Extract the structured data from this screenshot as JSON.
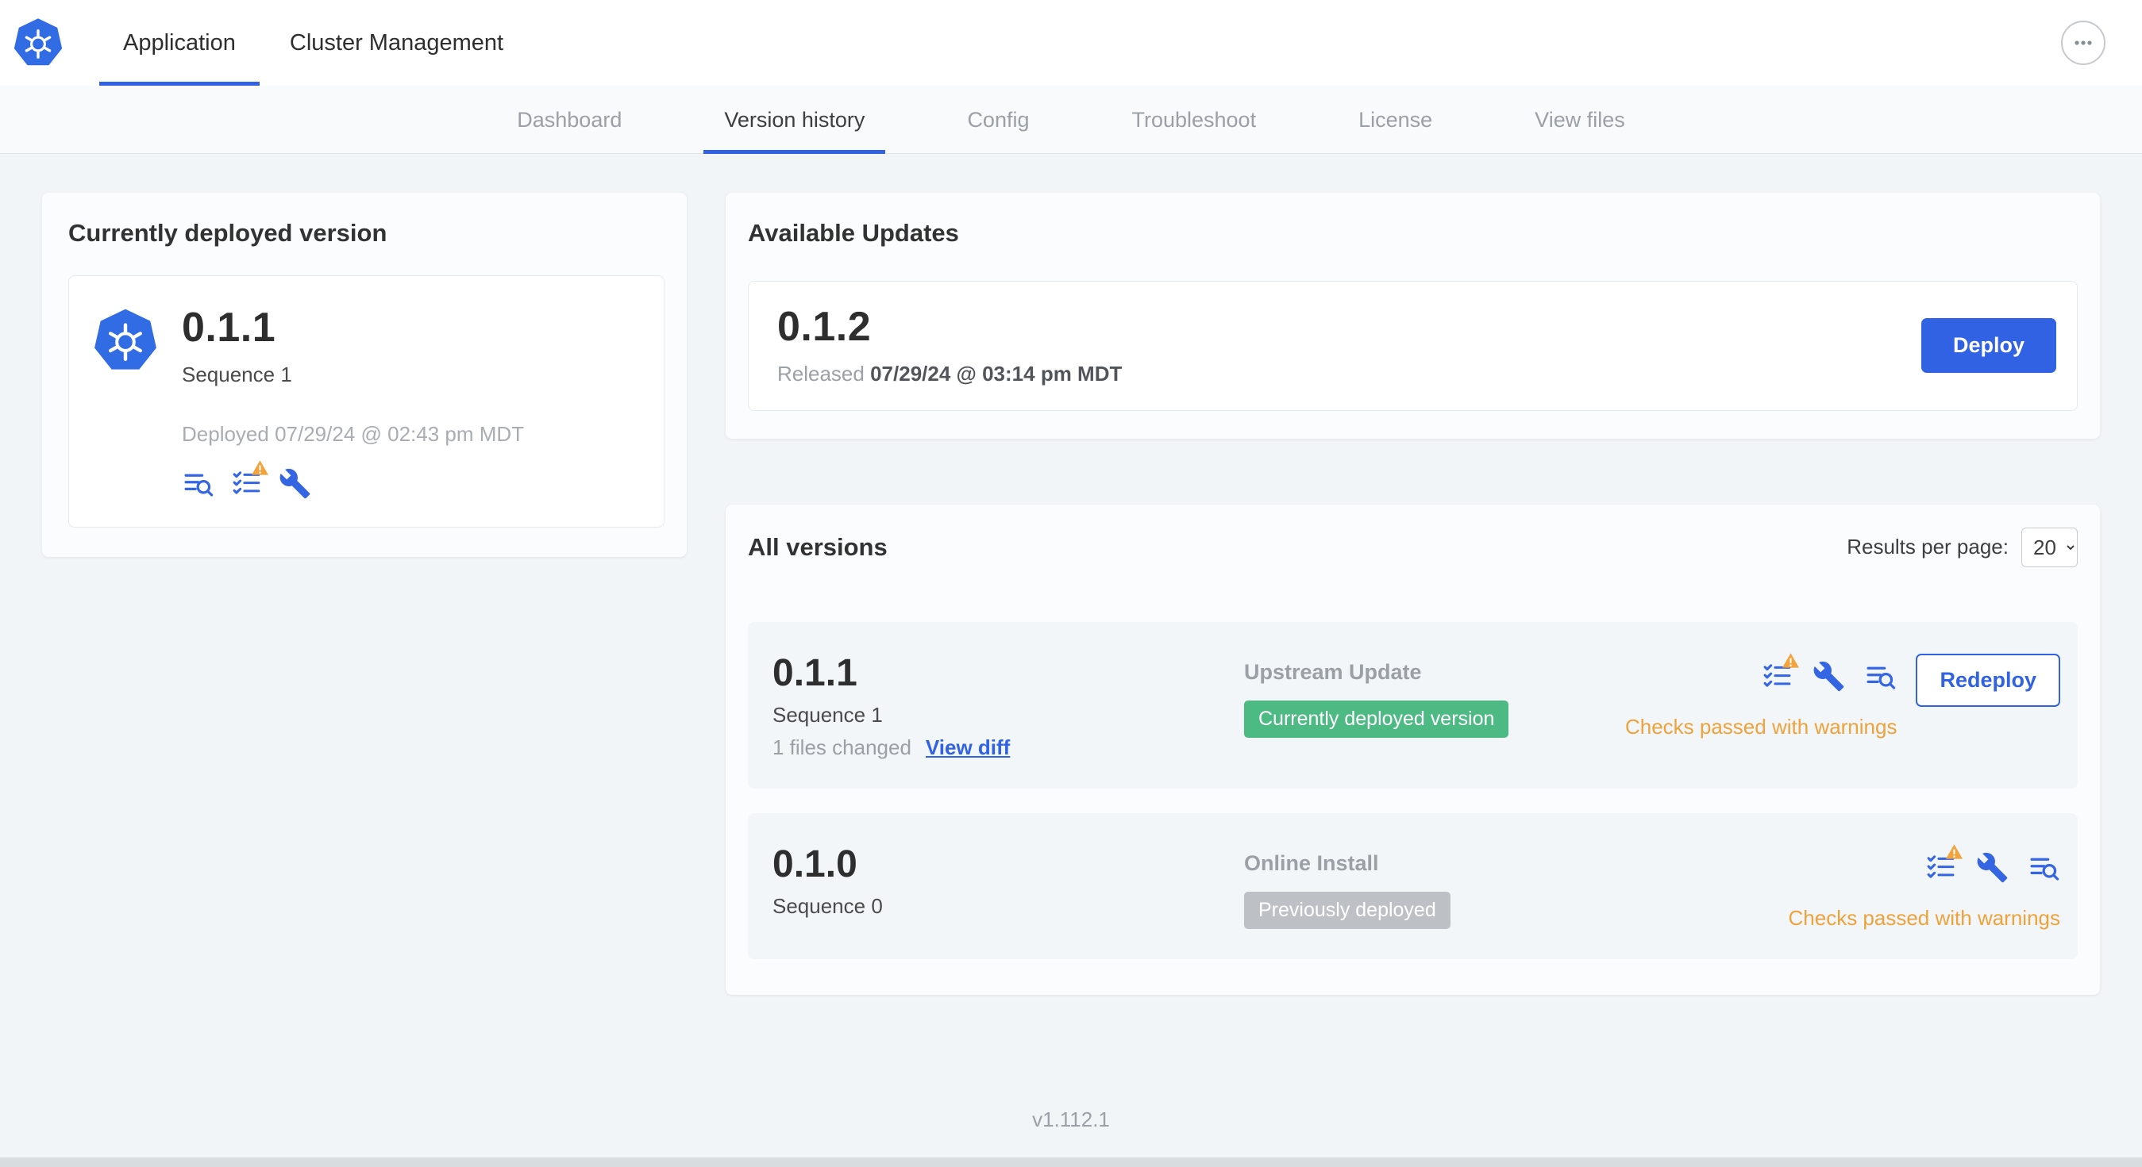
{
  "header": {
    "tabs": [
      {
        "label": "Application"
      },
      {
        "label": "Cluster Management"
      }
    ]
  },
  "nav": {
    "items": [
      "Dashboard",
      "Version history",
      "Config",
      "Troubleshoot",
      "License",
      "View files"
    ],
    "active_item": "Version history"
  },
  "current_version": {
    "title": "Currently deployed version",
    "version": "0.1.1",
    "sequence": "Sequence 1",
    "deployed": "Deployed 07/29/24 @ 02:43 pm MDT"
  },
  "available_updates": {
    "title": "Available Updates",
    "version": "0.1.2",
    "released_label": "Released",
    "released_date": "07/29/24 @ 03:14 pm MDT",
    "deploy_label": "Deploy"
  },
  "all_versions": {
    "title": "All versions",
    "results_per_page_label": "Results per page:",
    "results_per_page_value": "20",
    "rows": [
      {
        "version": "0.1.1",
        "sequence": "Sequence 1",
        "files_changed": "1 files changed",
        "view_diff_label": "View diff",
        "source": "Upstream Update",
        "badge": "Currently deployed version",
        "badge_type": "green",
        "checks_status": "Checks passed with warnings",
        "action_label": "Redeploy"
      },
      {
        "version": "0.1.0",
        "sequence": "Sequence 0",
        "source": "Online Install",
        "badge": "Previously deployed",
        "badge_type": "gray",
        "checks_status": "Checks passed with warnings"
      }
    ]
  },
  "footer": {
    "app_version": "v1.112.1"
  },
  "icons": {
    "logo": "kubernetes-helm-wheel",
    "more": "ellipsis-in-circle",
    "preflight": "checklist-with-warning-triangle",
    "config": "wrench",
    "release_notes": "lines-with-magnifier"
  },
  "colors": {
    "accent_blue": "#3162e4",
    "kubernetes_blue": "#326ce5",
    "badge_green": "#4dba83",
    "badge_gray": "#bdc1c5",
    "warning_orange": "#eda23b",
    "page_background": "#f2f5f7"
  }
}
